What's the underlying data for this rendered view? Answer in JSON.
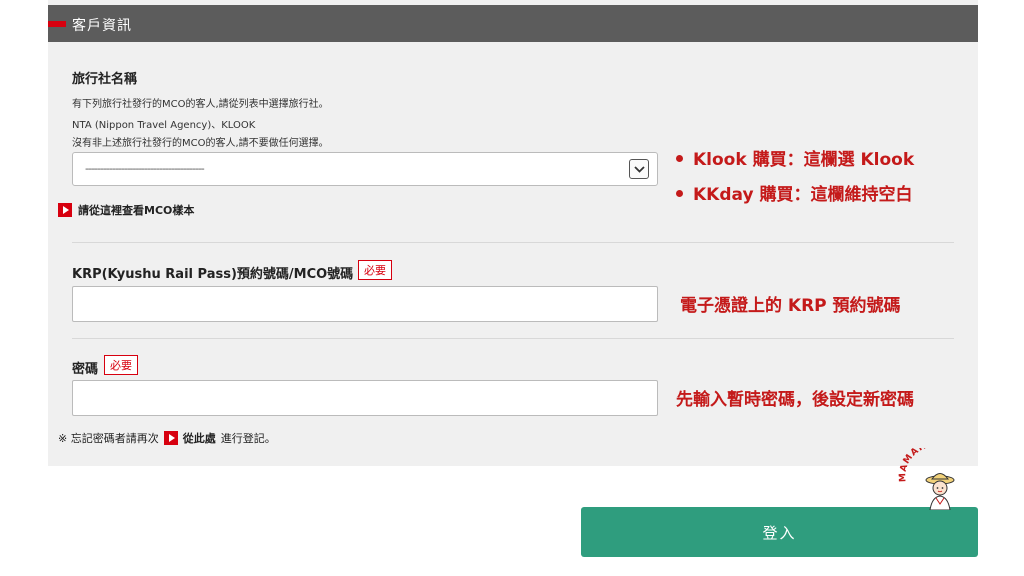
{
  "panel": {
    "header_title": "客戶資訊"
  },
  "agency": {
    "label": "旅行社名稱",
    "desc_1": "有下列旅行社發行的MCO的客人,請從列表中選擇旅行社。",
    "desc_2": "NTA (Nippon Travel Agency)、KLOOK",
    "desc_3": "沒有非上述旅行社發行的MCO的客人,請不要做任何選擇。",
    "select_value": "----------------------------------------",
    "sample_link": "請從這裡查看MCO樣本"
  },
  "krp": {
    "label": "KRP(Kyushu Rail Pass)預約號碼/MCO號碼",
    "required": "必要",
    "value": ""
  },
  "password": {
    "label": "密碼",
    "required": "必要",
    "value": ""
  },
  "note": {
    "prefix": "※ 忘記密碼者請再次",
    "link": "從此處",
    "suffix": "進行登記。"
  },
  "annotations": {
    "klook": "Klook 購買：這欄選 Klook",
    "kkday": "KKday 購買：這欄維持空白",
    "krp_hint": "電子憑證上的 KRP 預約號碼",
    "password_hint": "先輸入暫時密碼，後設定新密碼"
  },
  "login_button": "登入",
  "logo_text": "MAMAHUHU",
  "colors": {
    "accent_red": "#d7000f",
    "annotation_red": "#c41a1a",
    "button_green": "#2f9d7e",
    "header_gray": "#5c5c5c"
  }
}
